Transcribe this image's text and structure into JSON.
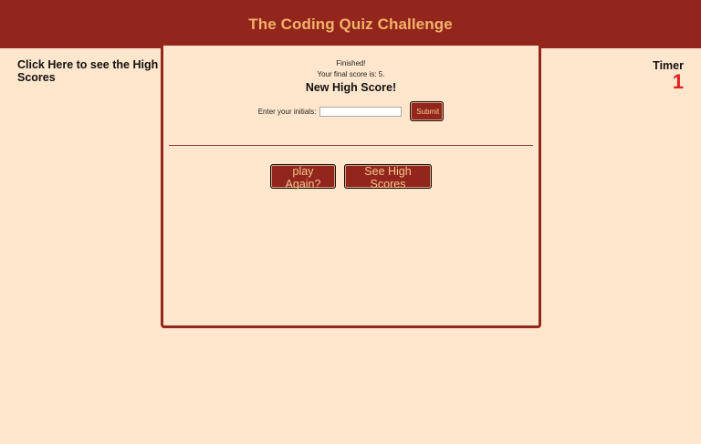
{
  "header": {
    "title": "The Coding Quiz Challenge"
  },
  "sidebar": {
    "highscores_link": "Click Here to see the High Scores"
  },
  "timer": {
    "label": "Timer",
    "value": "1"
  },
  "quiz": {
    "finished_text": "Finished!",
    "final_score_text": "Your final score is: 5.",
    "new_high_score_text": "New High Score!",
    "initials_label": "Enter your initials:",
    "initials_value": "",
    "submit_label": "Submit",
    "play_again_label": "play Again?",
    "see_high_scores_label": "See High Scores"
  },
  "colors": {
    "brand": "#92261c",
    "background": "#ffe6cc",
    "title_text": "#f3b26a",
    "timer_value": "#e02020"
  }
}
